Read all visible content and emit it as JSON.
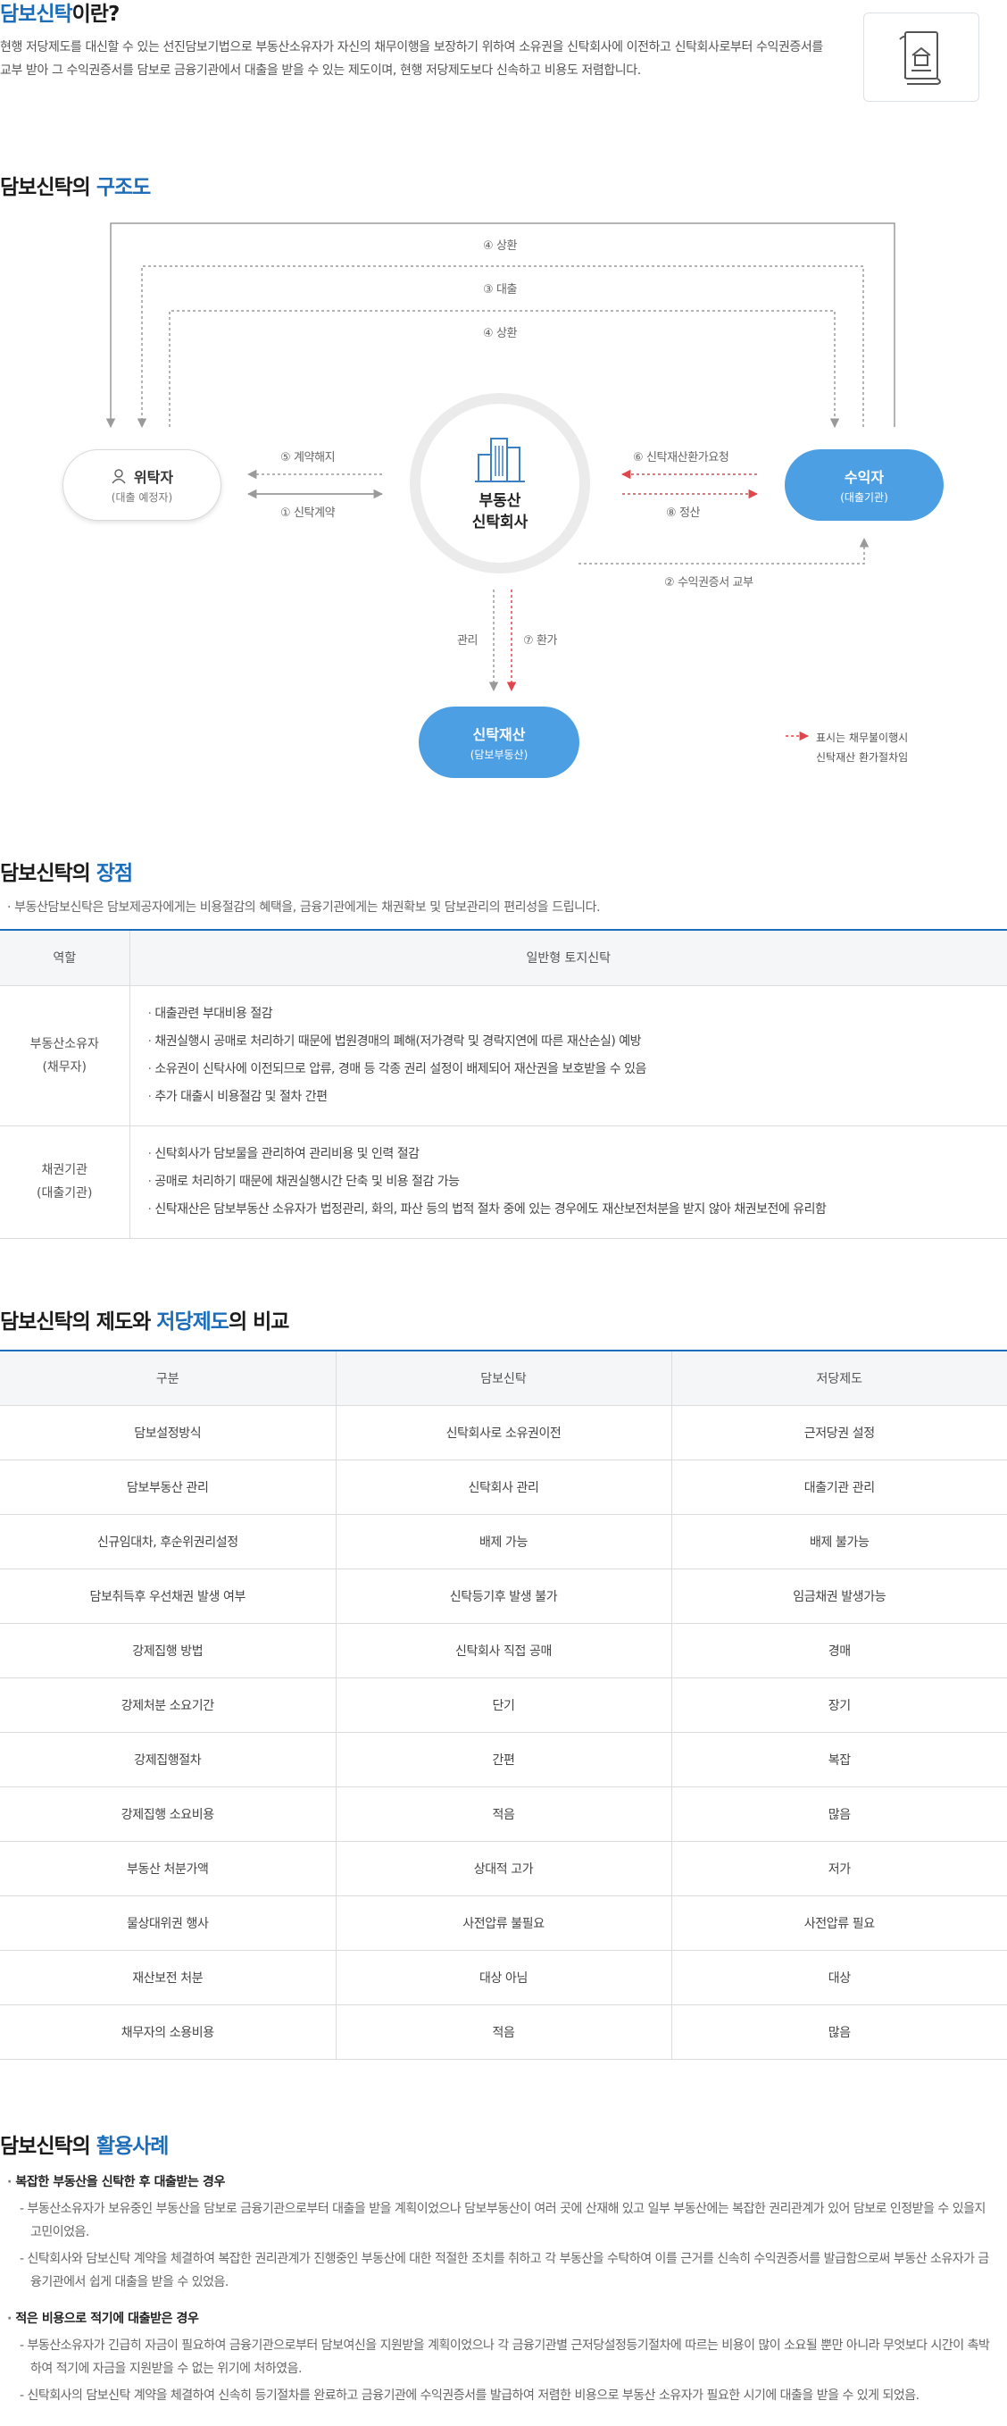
{
  "intro": {
    "title_main": "담보신탁",
    "title_rest": "이란?",
    "text": "현행 저당제도를 대신할 수 있는 선진담보기법으로 부동산소유자가 자신의 채무이행을 보장하기 위하여 소유권을 신탁회사에 이전하고 신탁회사로부터 수익권증서를 교부 받아 그 수익권증서를 담보로 금융기관에서 대출을 받을 수 있는 제도이며, 현행 저당제도보다 신속하고 비용도 저렴합니다.",
    "icon": "document-house-icon"
  },
  "structure": {
    "title_pre": "담보신탁의 ",
    "title_hl": "구조도",
    "trustor_name": "위탁자",
    "trustor_sub": "(대출 예정자)",
    "beneficiary_name": "수익자",
    "beneficiary_sub": "(대출기관)",
    "company_line1": "부동산",
    "company_line2": "신탁회사",
    "asset_name": "신탁재산",
    "asset_sub": "(담보부동산)",
    "labels": {
      "repay_outer": "④ 상환",
      "loan": "③ 대출",
      "repay_inner": "④ 상환",
      "terminate": "⑤ 계약해지",
      "contract": "① 신탁계약",
      "request": "⑥ 신탁재산환가요청",
      "settle": "⑧ 정산",
      "certificate": "② 수익권증서 교부",
      "manage": "관리",
      "convert": "⑦ 환가"
    },
    "legend_line1": "표시는 채무불이행시",
    "legend_line2": "신탁재산 환가절차임",
    "colors": {
      "accent": "#4d9fe3",
      "red": "#e0474c",
      "line": "#a9a9a9"
    }
  },
  "advantages": {
    "title_pre": "담보신탁의 ",
    "title_hl": "장점",
    "note": "부동산담보신탁은 담보제공자에게는 비용절감의 혜택을, 금융기관에게는 채권확보 및 담보관리의 편리성을 드립니다.",
    "col_role": "역할",
    "col_type": "일반형 토지신탁",
    "rows": [
      {
        "role1": "부동산소유자",
        "role2": "(채무자)",
        "items": [
          "대출관련 부대비용 절감",
          "채권실행시 공매로 처리하기 때문에 법원경매의 폐해(저가경락 및 경락지연에 따른 재산손실) 예방",
          "소유권이 신탁사에 이전되므로 압류, 경매 등 각종 권리 설정이 배제되어 재산권을 보호받을 수 있음",
          "추가 대출시 비용절감 및 절차 간편"
        ]
      },
      {
        "role1": "채권기관",
        "role2": "(대출기관)",
        "items": [
          "신탁회사가 담보물을 관리하여 관리비용 및 인력 절감",
          "공매로 처리하기 때문에 채권실행시간 단축 및 비용 절감 가능",
          "신탁재산은 담보부동산 소유자가 법정관리, 화의, 파산 등의 법적 절차 중에 있는 경우에도 재산보전처분을 받지 않아 채권보전에 유리함"
        ]
      }
    ]
  },
  "comparison": {
    "title_pre": "담보신탁의 제도와 ",
    "title_hl": "저당제도",
    "title_post": "의 비교",
    "headers": [
      "구분",
      "담보신탁",
      "저당제도"
    ],
    "rows": [
      [
        "담보설정방식",
        "신탁회사로 소유권이전",
        "근저당권 설정"
      ],
      [
        "담보부동산 관리",
        "신탁회사 관리",
        "대출기관 관리"
      ],
      [
        "신규임대차, 후순위권리설정",
        "배제 가능",
        "배제 불가능"
      ],
      [
        "담보취득후 우선채권 발생 여부",
        "신탁등기후 발생 불가",
        "임금채권 발생가능"
      ],
      [
        "강제집행 방법",
        "신탁회사 직접 공매",
        "경매"
      ],
      [
        "강제처분 소요기간",
        "단기",
        "장기"
      ],
      [
        "강제집행절차",
        "간편",
        "복잡"
      ],
      [
        "강제집행 소요비용",
        "적음",
        "많음"
      ],
      [
        "부동산 처분가액",
        "상대적 고가",
        "저가"
      ],
      [
        "물상대위권 행사",
        "사전압류 불필요",
        "사전압류 필요"
      ],
      [
        "재산보전 처분",
        "대상 아님",
        "대상"
      ],
      [
        "채무자의 소용비용",
        "적음",
        "많음"
      ]
    ]
  },
  "cases": {
    "title_pre": "담보신탁의 ",
    "title_hl": "활용사례",
    "groups": [
      {
        "head": "복잡한 부동산을 신탁한 후 대출받는 경우",
        "items": [
          "부동산소유자가 보유중인 부동산을 담보로 금융기관으로부터 대출을 받을 계획이었으나 담보부동산이 여러 곳에 산재해 있고 일부 부동산에는 복잡한 권리관계가 있어 담보로 인정받을 수 있을지 고민이었음.",
          "신탁회사와 담보신탁 계약을 체결하여 복잡한 권리관계가 진행중인 부동산에 대한 적절한 조치를 취하고 각 부동산을 수탁하여 이를 근거를 신속히 수익권증서를 발급함으로써 부동산 소유자가 금융기관에서 쉽게 대출을 받을 수 있었음."
        ]
      },
      {
        "head": "적은 비용으로 적기에 대출받은 경우",
        "items": [
          "부동산소유자가 긴급히 자금이 필요하여 금융기관으로부터 담보여신을 지원받을 계획이었으나 각 금융기관별 근저당설정등기절차에 따르는 비용이 많이 소요될 뿐만 아니라 무엇보다 시간이 촉박하여 적기에 자금을 지원받을 수 없는 위기에 처하였음.",
          "신탁회사의 담보신탁 계약을 체결하여 신속히 등기절차를 완료하고 금융기관에 수익권증서를 발급하여 저렴한 비용으로 부동산 소유자가 필요한 시기에 대출을 받을 수 있게 되었음."
        ]
      }
    ]
  }
}
